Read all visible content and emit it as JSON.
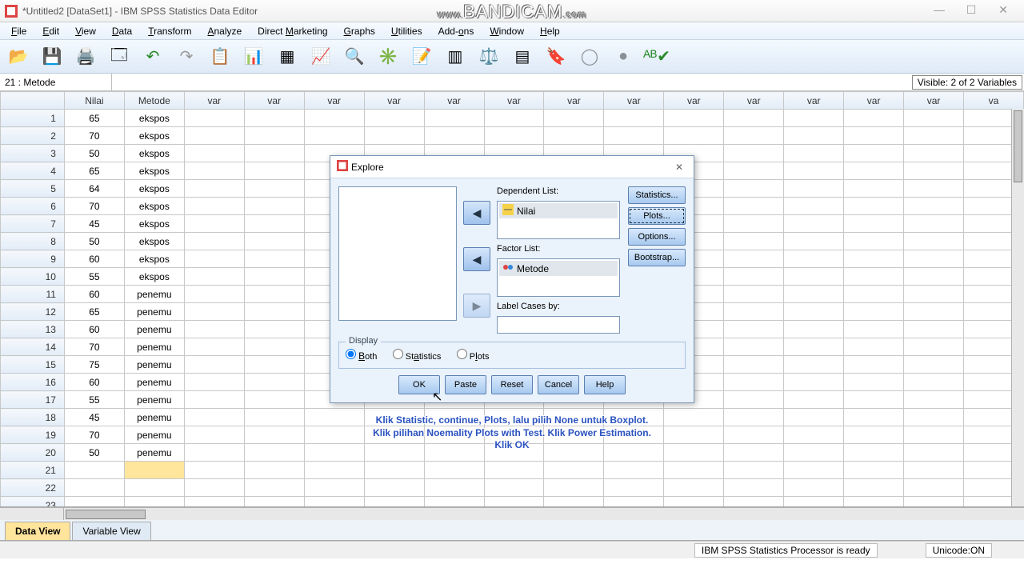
{
  "window": {
    "title": "*Untitled2 [DataSet1] - IBM SPSS Statistics Data Editor"
  },
  "watermark": "www.BANDICAM.com",
  "menu": [
    "File",
    "Edit",
    "View",
    "Data",
    "Transform",
    "Analyze",
    "Direct Marketing",
    "Graphs",
    "Utilities",
    "Add-ons",
    "Window",
    "Help"
  ],
  "cellbar": {
    "name": "21 : Metode",
    "visible": "Visible: 2 of 2 Variables"
  },
  "columns": [
    "Nilai",
    "Metode",
    "var",
    "var",
    "var",
    "var",
    "var",
    "var",
    "var",
    "var",
    "var",
    "var",
    "var",
    "var",
    "var",
    "va"
  ],
  "rows": [
    {
      "n": "1",
      "nilai": "65",
      "metode": "ekspos"
    },
    {
      "n": "2",
      "nilai": "70",
      "metode": "ekspos"
    },
    {
      "n": "3",
      "nilai": "50",
      "metode": "ekspos"
    },
    {
      "n": "4",
      "nilai": "65",
      "metode": "ekspos"
    },
    {
      "n": "5",
      "nilai": "64",
      "metode": "ekspos"
    },
    {
      "n": "6",
      "nilai": "70",
      "metode": "ekspos"
    },
    {
      "n": "7",
      "nilai": "45",
      "metode": "ekspos"
    },
    {
      "n": "8",
      "nilai": "50",
      "metode": "ekspos"
    },
    {
      "n": "9",
      "nilai": "60",
      "metode": "ekspos"
    },
    {
      "n": "10",
      "nilai": "55",
      "metode": "ekspos"
    },
    {
      "n": "11",
      "nilai": "60",
      "metode": "penemu"
    },
    {
      "n": "12",
      "nilai": "65",
      "metode": "penemu"
    },
    {
      "n": "13",
      "nilai": "60",
      "metode": "penemu"
    },
    {
      "n": "14",
      "nilai": "70",
      "metode": "penemu"
    },
    {
      "n": "15",
      "nilai": "75",
      "metode": "penemu"
    },
    {
      "n": "16",
      "nilai": "60",
      "metode": "penemu"
    },
    {
      "n": "17",
      "nilai": "55",
      "metode": "penemu"
    },
    {
      "n": "18",
      "nilai": "45",
      "metode": "penemu"
    },
    {
      "n": "19",
      "nilai": "70",
      "metode": "penemu"
    },
    {
      "n": "20",
      "nilai": "50",
      "metode": "penemu"
    },
    {
      "n": "21",
      "nilai": "",
      "metode": ""
    },
    {
      "n": "22",
      "nilai": "",
      "metode": ""
    },
    {
      "n": "23",
      "nilai": "",
      "metode": ""
    }
  ],
  "tabs": {
    "data": "Data View",
    "var": "Variable View"
  },
  "status": {
    "proc": "IBM SPSS Statistics Processor is ready",
    "unicode": "Unicode:ON"
  },
  "dialog": {
    "title": "Explore",
    "dep_label": "Dependent List:",
    "dep_item": "Nilai",
    "factor_label": "Factor List:",
    "factor_item": "Metode",
    "labelcases": "Label Cases by:",
    "display": "Display",
    "radio_both": "Both",
    "radio_stat": "Statistics",
    "radio_plots": "Plots",
    "side": {
      "stat": "Statistics...",
      "plots": "Plots...",
      "opt": "Options...",
      "boot": "Bootstrap..."
    },
    "foot": {
      "ok": "OK",
      "paste": "Paste",
      "reset": "Reset",
      "cancel": "Cancel",
      "help": "Help"
    }
  },
  "overlay": {
    "l1": "Klik Statistic, continue, Plots, lalu pilih None untuk Boxplot.",
    "l2": "Klik pilihan Noemality Plots with Test. Klik Power Estimation.",
    "l3": "Klik OK"
  }
}
